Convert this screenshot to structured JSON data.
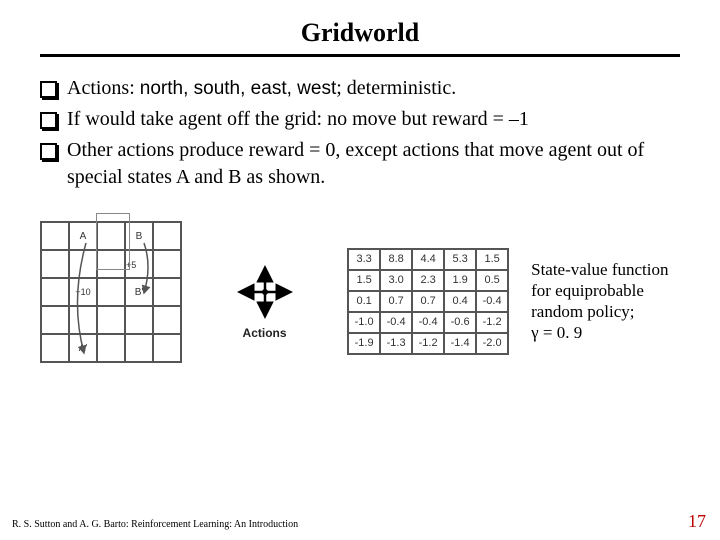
{
  "title": "Gridworld",
  "bullets": [
    {
      "prefix": "Actions: ",
      "actions": "north, south, east, west",
      "suffix": "; deterministic."
    },
    {
      "text": "If would take agent off the grid: no move but reward = –1"
    },
    {
      "text": "Other actions produce reward = 0, except actions that move agent out of special states A and B as shown."
    }
  ],
  "left_grid": {
    "labels": {
      "A": "A",
      "B": "B",
      "Bprime": "B'",
      "Aprime": "A'",
      "rewardA": "+10",
      "rewardB": "+5"
    }
  },
  "actions_label": "Actions",
  "value_grid": [
    [
      "3.3",
      "8.8",
      "4.4",
      "5.3",
      "1.5"
    ],
    [
      "1.5",
      "3.0",
      "2.3",
      "1.9",
      "0.5"
    ],
    [
      "0.1",
      "0.7",
      "0.7",
      "0.4",
      "-0.4"
    ],
    [
      "-1.0",
      "-0.4",
      "-0.4",
      "-0.6",
      "-1.2"
    ],
    [
      "-1.9",
      "-1.3",
      "-1.2",
      "-1.4",
      "-2.0"
    ]
  ],
  "caption_line1": "State-value function for equiprobable random policy;",
  "caption_line2": "γ = 0. 9",
  "footer_left": "R. S. Sutton and A. G. Barto: Reinforcement Learning: An Introduction",
  "footer_right": "17"
}
